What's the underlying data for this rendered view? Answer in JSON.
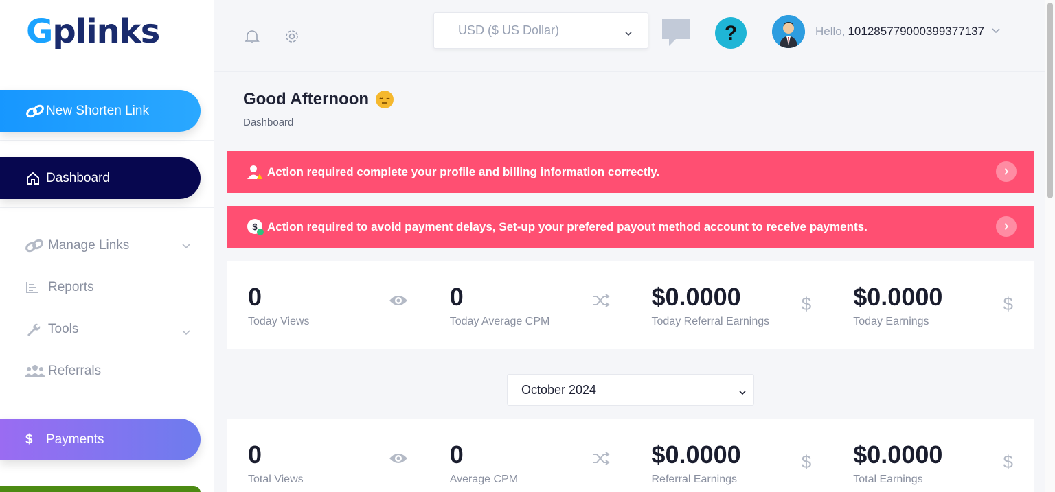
{
  "brand": {
    "logo_text_g": "G",
    "logo_text_rest": "plinks"
  },
  "sidebar": {
    "new_link": "New Shorten Link",
    "dashboard": "Dashboard",
    "items": [
      {
        "label": "Manage Links",
        "icon": "link-icon",
        "expandable": true
      },
      {
        "label": "Reports",
        "icon": "bar-chart-icon",
        "expandable": false
      },
      {
        "label": "Tools",
        "icon": "wrench-icon",
        "expandable": true
      },
      {
        "label": "Referrals",
        "icon": "users-icon",
        "expandable": false
      }
    ],
    "payments": "Payments"
  },
  "header": {
    "currency": "USD ($ US Dollar)",
    "hello": "Hello,",
    "user_id": "101285779000399377137"
  },
  "page": {
    "title": "Good Afternoon",
    "breadcrumb": "Dashboard"
  },
  "alerts": [
    {
      "text": "Action required complete your profile and billing information correctly."
    },
    {
      "text": "Action required to avoid payment delays, Set-up your prefered payout method account to receive payments."
    }
  ],
  "today_stats": [
    {
      "value": "0",
      "label": "Today Views",
      "icon": "eye-icon"
    },
    {
      "value": "0",
      "label": "Today Average CPM",
      "icon": "shuffle-icon"
    },
    {
      "value": "$0.0000",
      "label": "Today Referral Earnings",
      "icon": "dollar-icon"
    },
    {
      "value": "$0.0000",
      "label": "Today Earnings",
      "icon": "dollar-icon"
    }
  ],
  "month_select": "October 2024",
  "total_stats": [
    {
      "value": "0",
      "label": "Total Views",
      "icon": "eye-icon"
    },
    {
      "value": "0",
      "label": "Average CPM",
      "icon": "shuffle-icon"
    },
    {
      "value": "$0.0000",
      "label": "Referral Earnings",
      "icon": "dollar-icon"
    },
    {
      "value": "$0.0000",
      "label": "Total Earnings",
      "icon": "dollar-icon"
    }
  ],
  "colors": {
    "primary": "#1797ff",
    "navy": "#07074f",
    "alert": "#ff4f72",
    "help": "#1fb5d6"
  }
}
